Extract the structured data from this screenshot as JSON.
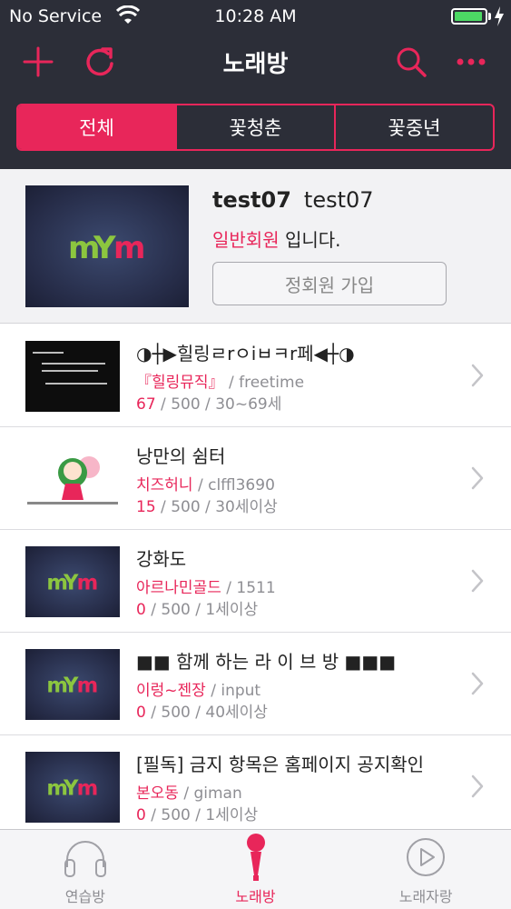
{
  "status_bar": {
    "carrier": "No Service",
    "time": "10:28 AM",
    "battery_level": 0.95
  },
  "nav": {
    "title": "노래방",
    "segments": [
      "전체",
      "꽃청춘",
      "꽃중년"
    ],
    "active_segment": 0
  },
  "profile": {
    "user_id": "test07",
    "nickname": "test07",
    "grade": "일반회원",
    "grade_suffix": "입니다.",
    "join_button": "정회원 가입",
    "logo_text": "mm"
  },
  "rooms": [
    {
      "title": "◑┼▶힐링ㄹrㅇiㅂㅋr페◀┼◑",
      "nick": "『힐링뮤직』",
      "user": "freetime",
      "current": "67",
      "capacity": "500",
      "age": "30~69세",
      "thumb": "dark"
    },
    {
      "title": "낭만의 쉼터",
      "nick": "치즈허니",
      "user": "clffl3690",
      "current": "15",
      "capacity": "500",
      "age": "30세이상",
      "thumb": "anime"
    },
    {
      "title": "강화도",
      "nick": "아르나민골드",
      "user": "1511",
      "current": "0",
      "capacity": "500",
      "age": "1세이상",
      "thumb": "logo"
    },
    {
      "title": "■■ 함께 하는 라 이 브 방 ■■■",
      "nick": "이렁~젠장",
      "user": "input",
      "current": "0",
      "capacity": "500",
      "age": "40세이상",
      "thumb": "logo"
    },
    {
      "title": "[필독] 금지 항목은 홈페이지 공지확인",
      "nick": "본오동",
      "user": "giman",
      "current": "0",
      "capacity": "500",
      "age": "1세이상",
      "thumb": "logo"
    }
  ],
  "tabs": [
    {
      "label": "연습방",
      "icon": "headphones-icon"
    },
    {
      "label": "노래방",
      "icon": "microphone-icon"
    },
    {
      "label": "노래자랑",
      "icon": "play-circle-icon"
    }
  ],
  "active_tab": 1,
  "colors": {
    "accent": "#e8265a",
    "nav_background": "#2c2e38",
    "battery": "#4cd964"
  }
}
